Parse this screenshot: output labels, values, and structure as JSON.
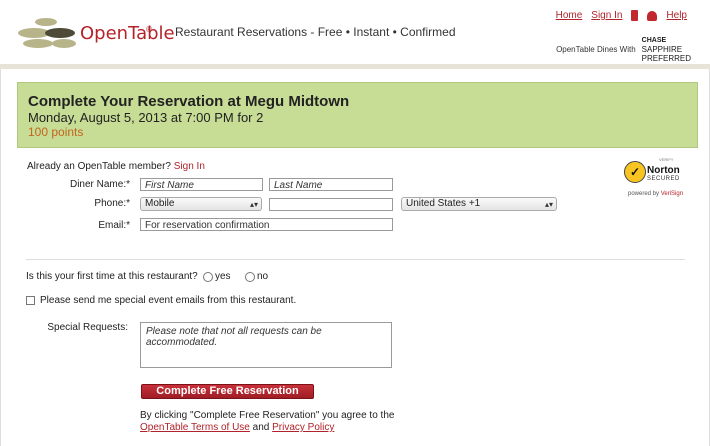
{
  "header": {
    "brand": "OpenTable",
    "brand_mark": "®",
    "tagline": "Restaurant Reservations - Free • Instant • Confirmed",
    "links": {
      "home": "Home",
      "sign_in": "Sign In",
      "help": "Help"
    },
    "sponsor_prefix": "OpenTable Dines With",
    "sponsor_line1": "CHASE",
    "sponsor_line2": "SAPPHIRE",
    "sponsor_line3": "PREFERRED"
  },
  "summary": {
    "title": "Complete Your Reservation at Megu Midtown",
    "date": "Monday, August 5, 2013 at 7:00 PM for 2",
    "points": "100 points"
  },
  "form": {
    "member_prompt": "Already an OpenTable member?",
    "member_link": "Sign In",
    "diner_label": "Diner Name:*",
    "first_placeholder": "First Name",
    "last_placeholder": "Last Name",
    "phone_label": "Phone:*",
    "phone_type": "Mobile",
    "phone_number": "",
    "country": "United States +1",
    "email_label": "Email:*",
    "email_placeholder": "For reservation confirmation"
  },
  "norton": {
    "verify": "VERIFY",
    "name": "Norton",
    "secured": "SECURED",
    "powered": "powered by",
    "verisign": "VeriSign"
  },
  "questions": {
    "first_time": "Is this your first time at this restaurant?",
    "yes": "yes",
    "no": "no",
    "emails": "Please send me special event emails from this restaurant."
  },
  "special": {
    "label": "Special Requests:",
    "placeholder": "Please note that not all requests can be accommodated."
  },
  "submit": {
    "label": "Complete Free Reservation",
    "agree_text": "By clicking \"Complete Free Reservation\" you agree to the",
    "terms": "OpenTable Terms of Use",
    "and": "and",
    "privacy": "Privacy Policy"
  },
  "colors": {
    "accent": "#b0232a",
    "panel": "#c7dc95",
    "points": "#c2661f"
  }
}
